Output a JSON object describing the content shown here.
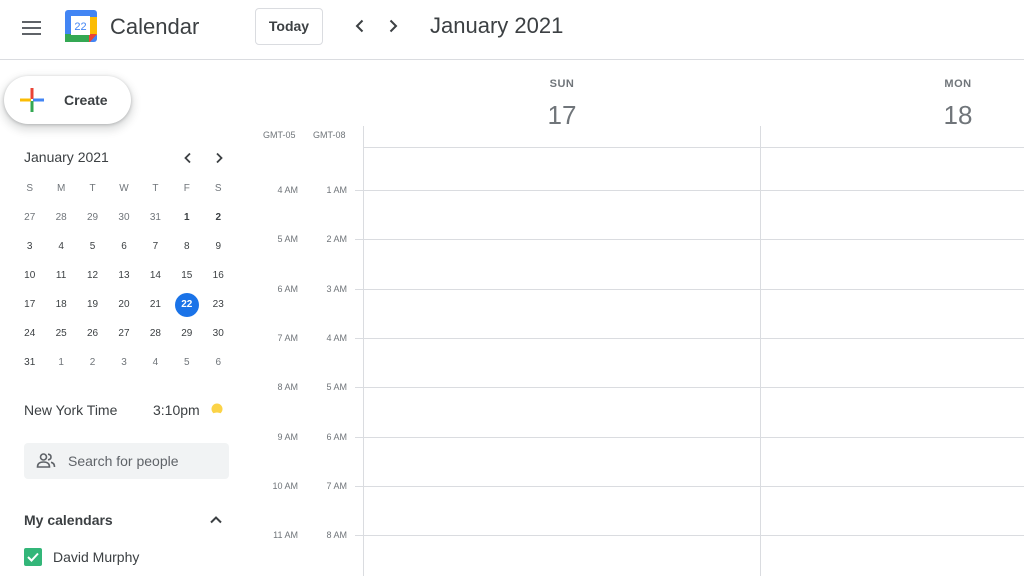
{
  "header": {
    "app_title": "Calendar",
    "logo_day": "22",
    "today_label": "Today",
    "period_title": "January 2021"
  },
  "create": {
    "label": "Create"
  },
  "mini_calendar": {
    "title": "January 2021",
    "weekday_heads": [
      "S",
      "M",
      "T",
      "W",
      "T",
      "F",
      "S"
    ],
    "weeks": [
      [
        "27",
        "28",
        "29",
        "30",
        "31",
        "1",
        "2"
      ],
      [
        "3",
        "4",
        "5",
        "6",
        "7",
        "8",
        "9"
      ],
      [
        "10",
        "11",
        "12",
        "13",
        "14",
        "15",
        "16"
      ],
      [
        "17",
        "18",
        "19",
        "20",
        "21",
        "22",
        "23"
      ],
      [
        "24",
        "25",
        "26",
        "27",
        "28",
        "29",
        "30"
      ],
      [
        "31",
        "1",
        "2",
        "3",
        "4",
        "5",
        "6"
      ]
    ],
    "today": "22"
  },
  "timezone": {
    "label": "New York Time",
    "time": "3:10pm"
  },
  "search_people": {
    "placeholder": "Search for people"
  },
  "my_calendars": {
    "title": "My calendars",
    "items": [
      {
        "name": "David Murphy",
        "color": "#33b679",
        "checked": true
      }
    ]
  },
  "grid": {
    "tz_primary": "GMT-05",
    "tz_secondary": "GMT-08",
    "days": [
      {
        "name": "SUN",
        "number": "17"
      },
      {
        "name": "MON",
        "number": "18"
      }
    ],
    "rows": [
      {
        "primary": "4 AM",
        "secondary": "1 AM"
      },
      {
        "primary": "5 AM",
        "secondary": "2 AM"
      },
      {
        "primary": "6 AM",
        "secondary": "3 AM"
      },
      {
        "primary": "7 AM",
        "secondary": "4 AM"
      },
      {
        "primary": "8 AM",
        "secondary": "5 AM"
      },
      {
        "primary": "9 AM",
        "secondary": "6 AM"
      },
      {
        "primary": "10 AM",
        "secondary": "7 AM"
      },
      {
        "primary": "11 AM",
        "secondary": "8 AM"
      }
    ]
  },
  "colors": {
    "accent": "#1a73e8",
    "calendar_green": "#33b679",
    "border": "#dadce0"
  }
}
